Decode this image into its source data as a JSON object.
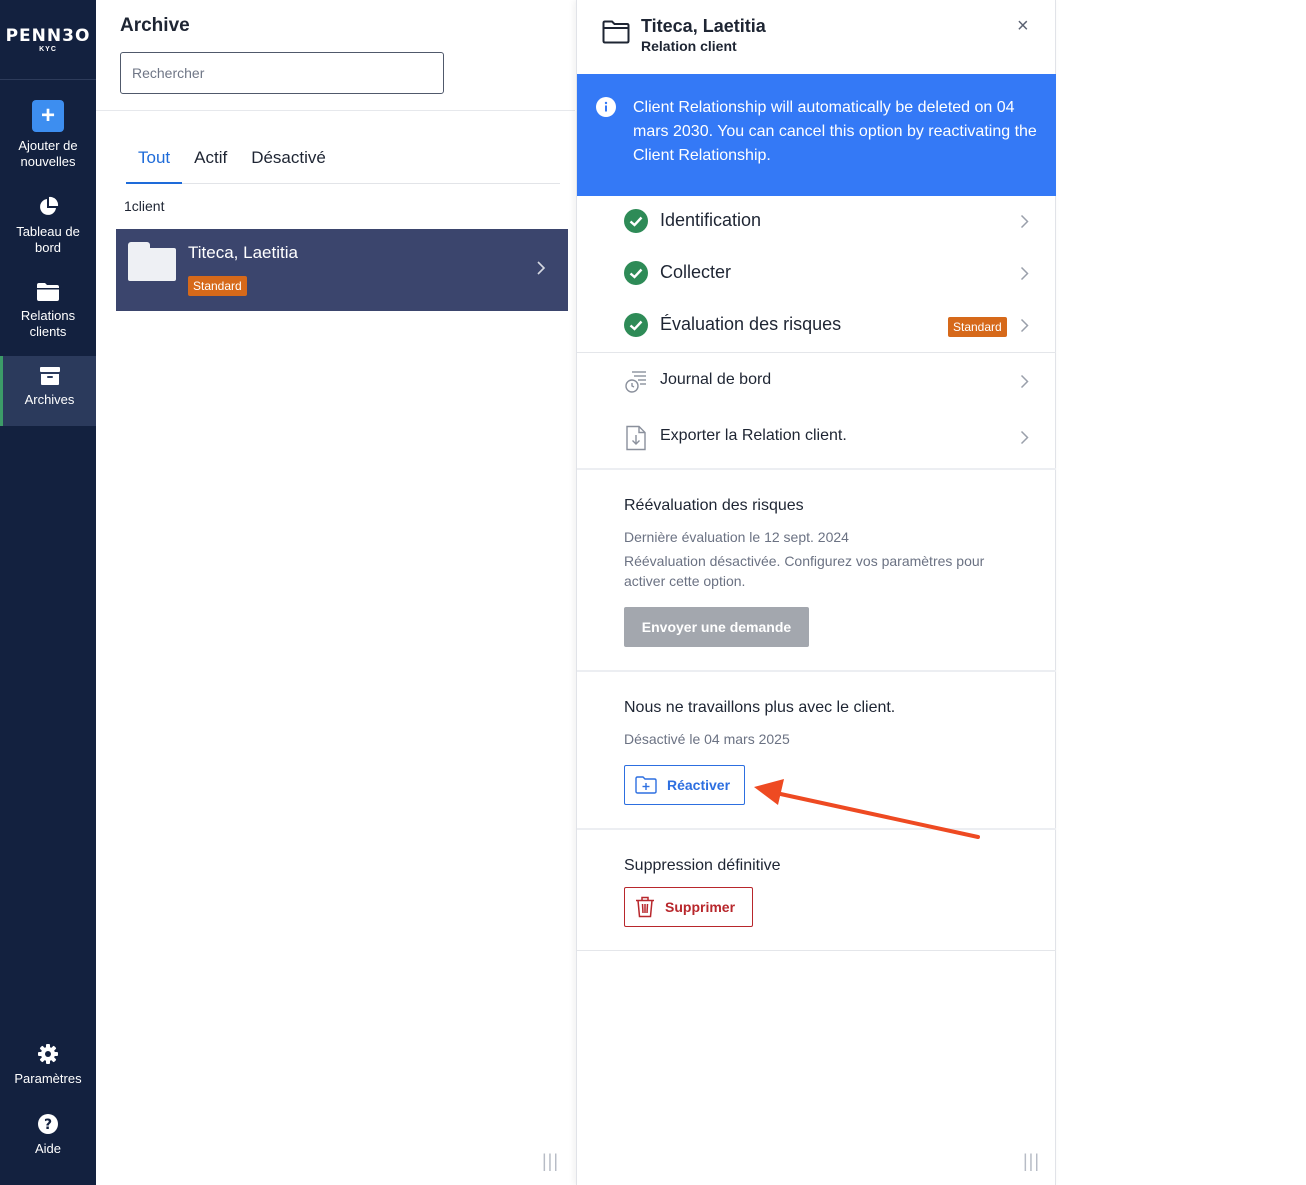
{
  "sidebar": {
    "logo_main": "PENN3O",
    "logo_sub": "KYC",
    "items": [
      {
        "label": "Ajouter de nouvelles",
        "icon": "plus-icon"
      },
      {
        "label": "Tableau de bord",
        "icon": "pie-chart-icon"
      },
      {
        "label": "Relations clients",
        "icon": "folder-icon"
      },
      {
        "label": "Archives",
        "icon": "archive-icon"
      }
    ],
    "bottom": [
      {
        "label": "Paramètres",
        "icon": "gear-icon"
      },
      {
        "label": "Aide",
        "icon": "help-icon"
      }
    ],
    "active_color": "#3c9b68",
    "background": "#13213f"
  },
  "list": {
    "title": "Archive",
    "search_placeholder": "Rechercher",
    "tabs": [
      {
        "label": "Tout",
        "active": true
      },
      {
        "label": "Actif",
        "active": false
      },
      {
        "label": "Désactivé",
        "active": false
      }
    ],
    "count": "1client",
    "clients": [
      {
        "name": "Titeca, Laetitia",
        "badge": "Standard"
      }
    ],
    "resize_glyph": "|||"
  },
  "detail": {
    "title": "Titeca, Laetitia",
    "subtitle": "Relation client",
    "close": "×",
    "banner": "Client Relationship will automatically be deleted on 04 mars 2030. You can cancel this option by reactivating the Client Relationship.",
    "steps": [
      {
        "label": "Identification",
        "done": true
      },
      {
        "label": "Collecter",
        "done": true
      },
      {
        "label": "Évaluation des risques",
        "done": true,
        "badge": "Standard"
      }
    ],
    "links": [
      {
        "label": "Journal de bord",
        "icon": "history-log-icon"
      },
      {
        "label": "Exporter la Relation client.",
        "icon": "export-file-icon"
      }
    ],
    "reassessment": {
      "title": "Réévaluation des risques",
      "last": "Dernière évaluation le 12 sept. 2024",
      "note": "Réévaluation désactivée. Configurez vos paramètres pour activer cette option.",
      "button": "Envoyer une demande"
    },
    "deactivated": {
      "title": "Nous ne travaillons plus avec le client.",
      "date": "Désactivé le 04 mars 2025",
      "button": "Réactiver"
    },
    "delete": {
      "title": "Suppression définitive",
      "button": "Supprimer"
    },
    "resize_glyph": "|||"
  },
  "colors": {
    "banner": "#3479f6",
    "badge": "#d6691a",
    "check": "#2e8b57",
    "selected_card": "#3b456d",
    "annotation_arrow": "#ee4a22"
  }
}
